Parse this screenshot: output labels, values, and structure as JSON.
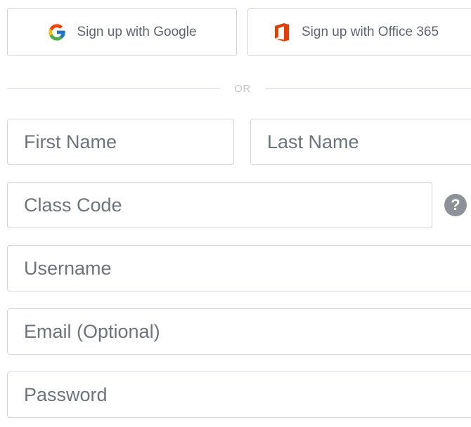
{
  "sso": {
    "google": {
      "label": "Sign up with Google",
      "icon": "google-g-icon"
    },
    "office": {
      "label": "Sign up with Office 365",
      "icon": "office-365-icon",
      "color": "#eb3c00"
    }
  },
  "divider": {
    "text": "OR"
  },
  "form": {
    "first_name": {
      "placeholder": "First Name",
      "value": ""
    },
    "last_name": {
      "placeholder": "Last Name",
      "value": ""
    },
    "class_code": {
      "placeholder": "Class Code",
      "value": ""
    },
    "class_code_help": {
      "glyph": "?",
      "icon": "help-circle-icon"
    },
    "username": {
      "placeholder": "Username",
      "value": ""
    },
    "email": {
      "placeholder": "Email (Optional)",
      "value": ""
    },
    "password": {
      "placeholder": "Password",
      "value": ""
    }
  },
  "colors": {
    "border": "#d3d6dc",
    "placeholder": "#6e747c",
    "divider_text": "#c3c7cd",
    "help_bg": "#8e9197"
  }
}
